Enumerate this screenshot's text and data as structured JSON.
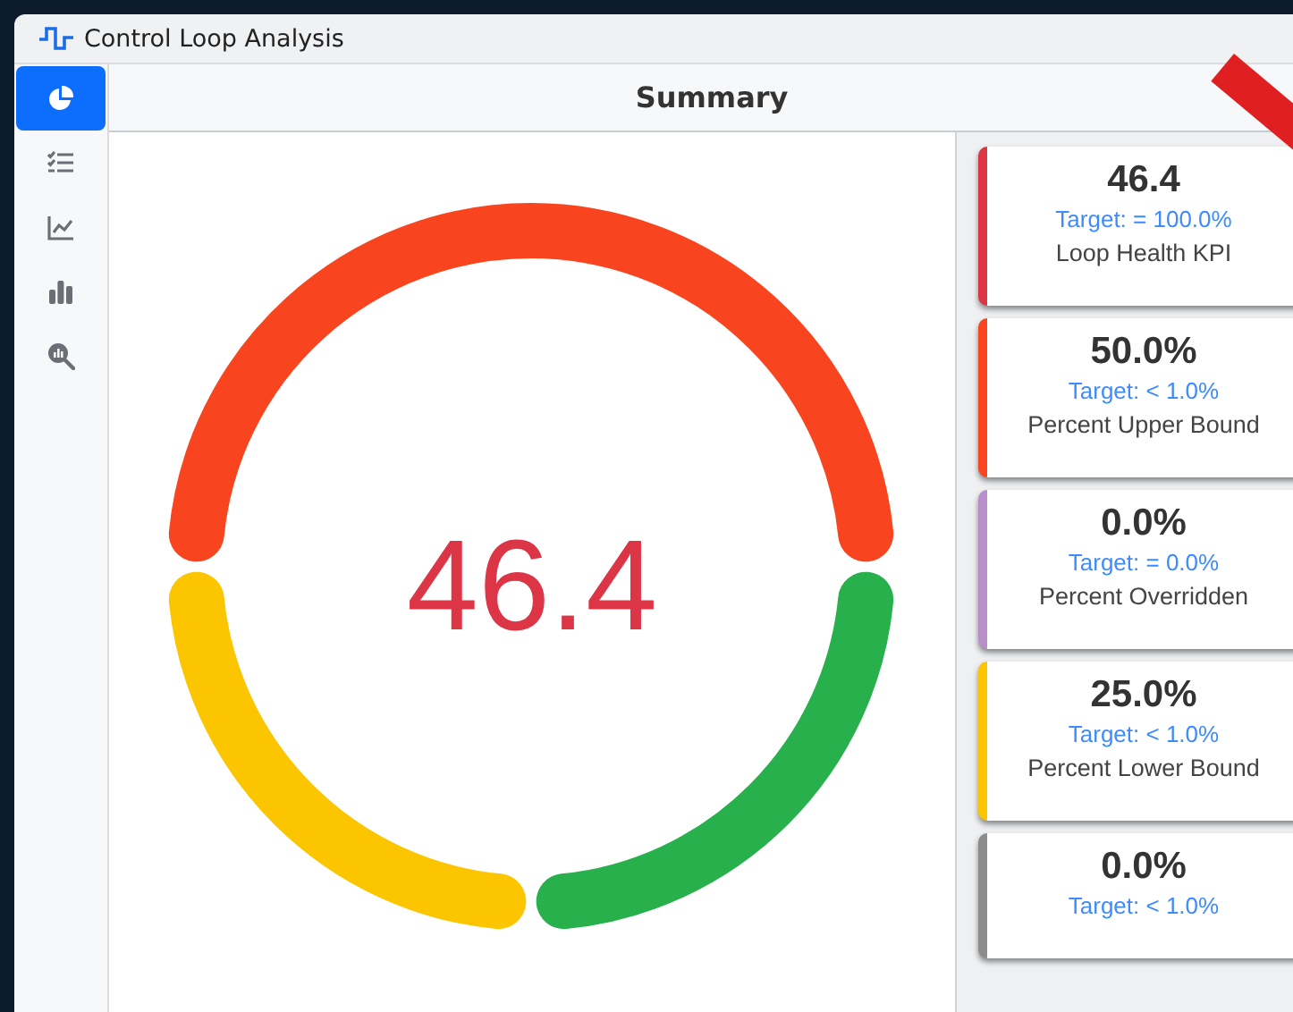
{
  "window": {
    "title": "Control Loop Analysis"
  },
  "sidebar": {
    "items": [
      {
        "kind": "pie",
        "selected": true
      },
      {
        "kind": "checklist",
        "selected": false
      },
      {
        "kind": "line",
        "selected": false
      },
      {
        "kind": "bars",
        "selected": false
      },
      {
        "kind": "zoom",
        "selected": false
      }
    ]
  },
  "header": {
    "title": "Summary"
  },
  "gauge": {
    "value": "46.4",
    "segments": [
      {
        "color": "#f8441f"
      },
      {
        "color": "#27b04b"
      },
      {
        "color": "#fbc500"
      }
    ]
  },
  "cards": [
    {
      "value": "46.4",
      "target": "Target: = 100.0%",
      "label": "Loop Health KPI",
      "color": "#dc3545"
    },
    {
      "value": "50.0%",
      "target": "Target: < 1.0%",
      "label": "Percent Upper Bound",
      "color": "#fb4420"
    },
    {
      "value": "0.0%",
      "target": "Target: = 0.0%",
      "label": "Percent Overridden",
      "color": "#b98fc9"
    },
    {
      "value": "25.0%",
      "target": "Target: < 1.0%",
      "label": "Percent Lower Bound",
      "color": "#fbc500"
    },
    {
      "value": "0.0%",
      "target": "Target: < 1.0%",
      "color": "#8c8c8c"
    }
  ]
}
